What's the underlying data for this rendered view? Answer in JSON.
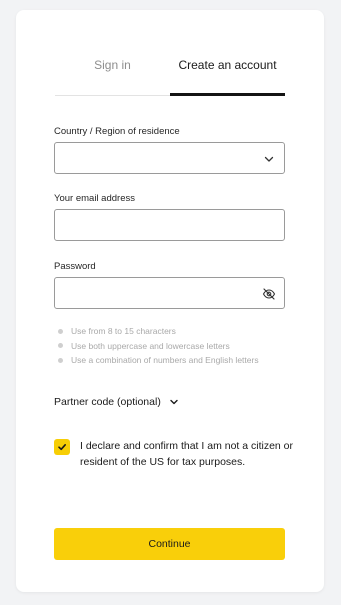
{
  "tabs": {
    "signin_label": "Sign in",
    "create_label": "Create an account",
    "active": "create"
  },
  "form": {
    "country": {
      "label": "Country / Region of residence",
      "value": ""
    },
    "email": {
      "label": "Your email address",
      "value": ""
    },
    "password": {
      "label": "Password",
      "value": ""
    }
  },
  "hints": [
    "Use from 8 to 15 characters",
    "Use both uppercase and lowercase letters",
    "Use a combination of numbers and English letters"
  ],
  "partner_label": "Partner code (optional)",
  "declaration": {
    "checked": true,
    "text": "I declare and confirm that I am not a citizen or resident of the US for tax purposes."
  },
  "continue_label": "Continue",
  "colors": {
    "accent": "#f9cf0a",
    "hint_text": "#a9a9a9"
  }
}
